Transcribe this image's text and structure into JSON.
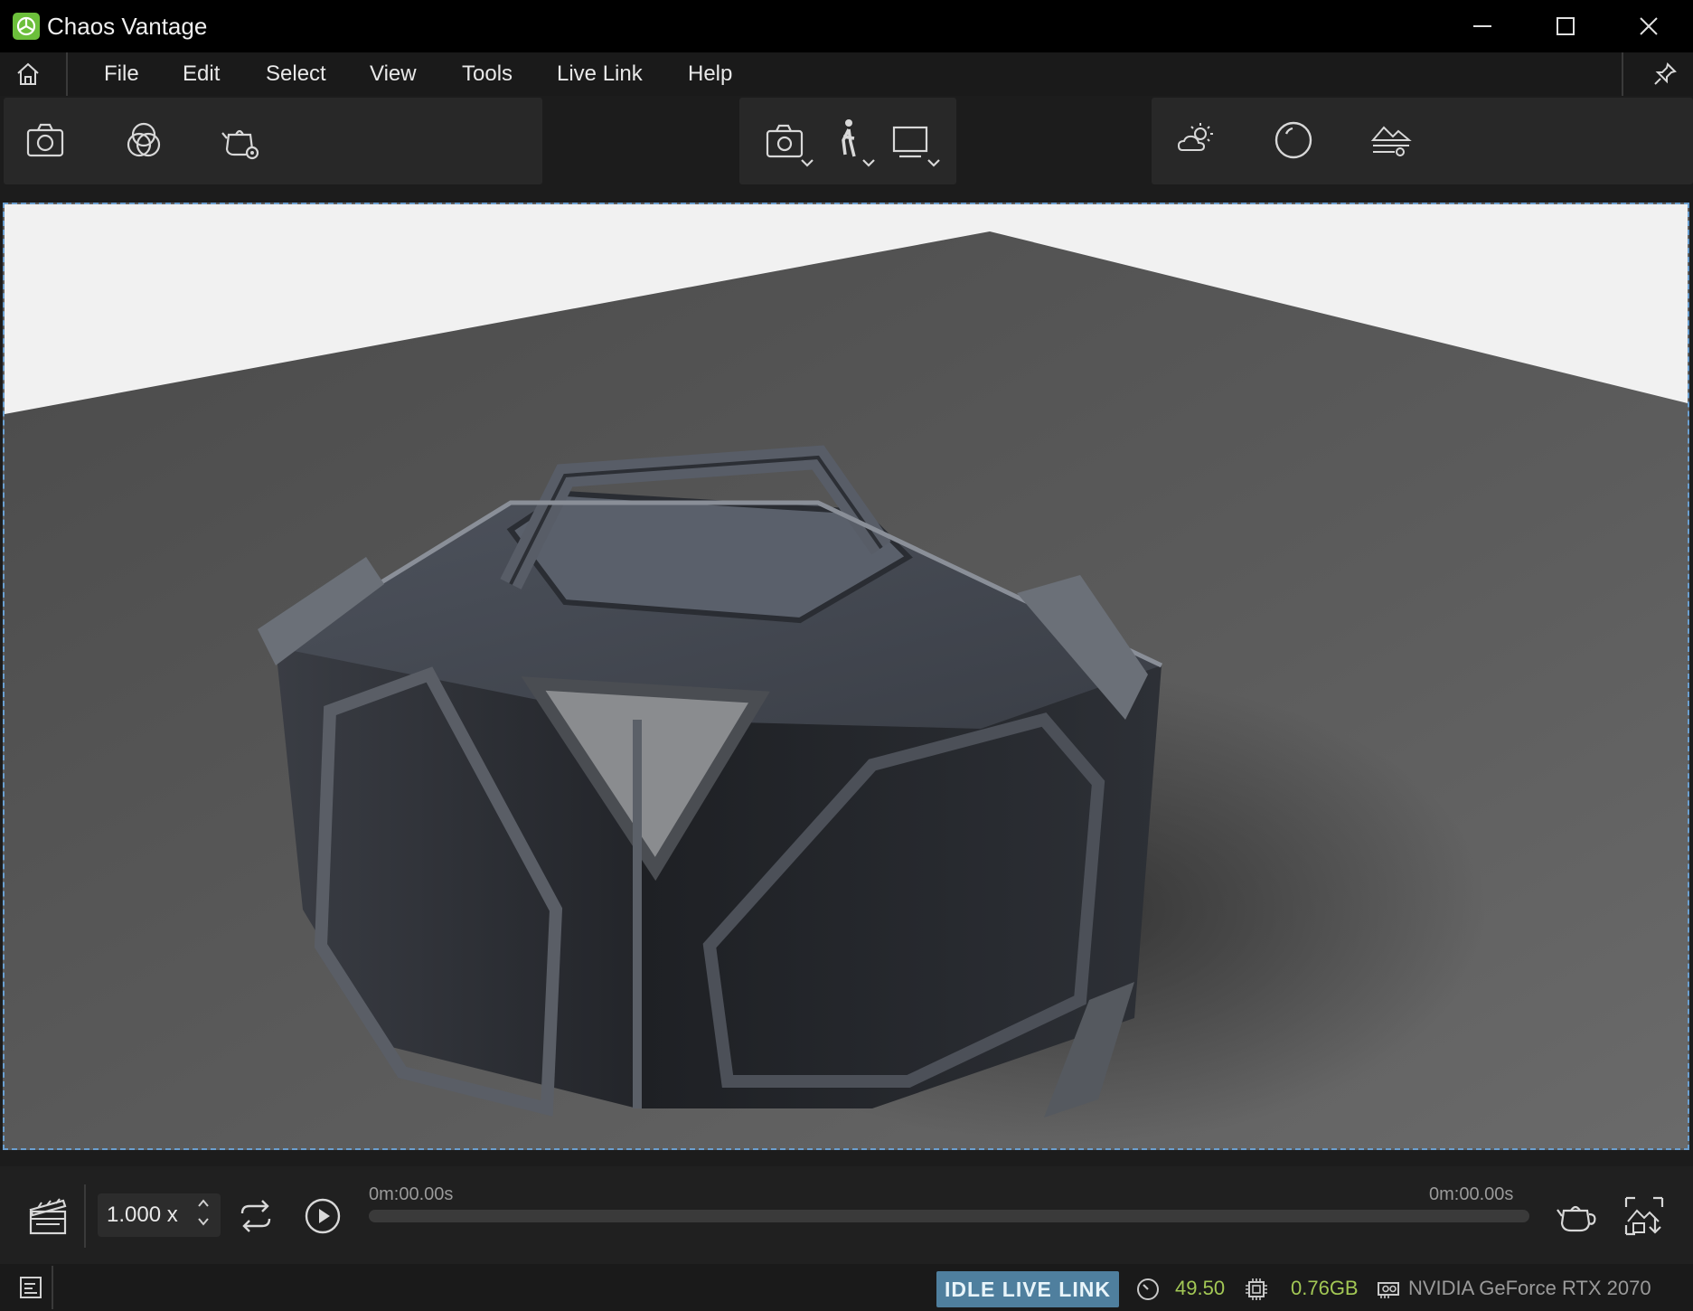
{
  "window": {
    "title": "Chaos Vantage"
  },
  "menu": {
    "items": [
      "File",
      "Edit",
      "Select",
      "View",
      "Tools",
      "Live Link",
      "Help"
    ]
  },
  "toolbar": {
    "left_icons": [
      "screenshot-icon",
      "materials-icon",
      "teapot-settings-icon"
    ],
    "center_icons": [
      "camera-dropdown-icon",
      "walk-mode-dropdown-icon",
      "display-dropdown-icon"
    ],
    "right_icons": [
      "environment-icon",
      "sphere-icon",
      "ground-settings-icon"
    ]
  },
  "playback": {
    "speed": "1.000 x",
    "time_start": "0m:00.00s",
    "time_end": "0m:00.00s",
    "progress": 0
  },
  "status": {
    "live_link_state": "IDLE LIVE LINK",
    "fps": "49.50",
    "vram": "0.76GB",
    "gpu": "NVIDIA GeForce RTX 2070",
    "accent_color": "#a3c855",
    "badge_color": "#4f7f9e"
  }
}
